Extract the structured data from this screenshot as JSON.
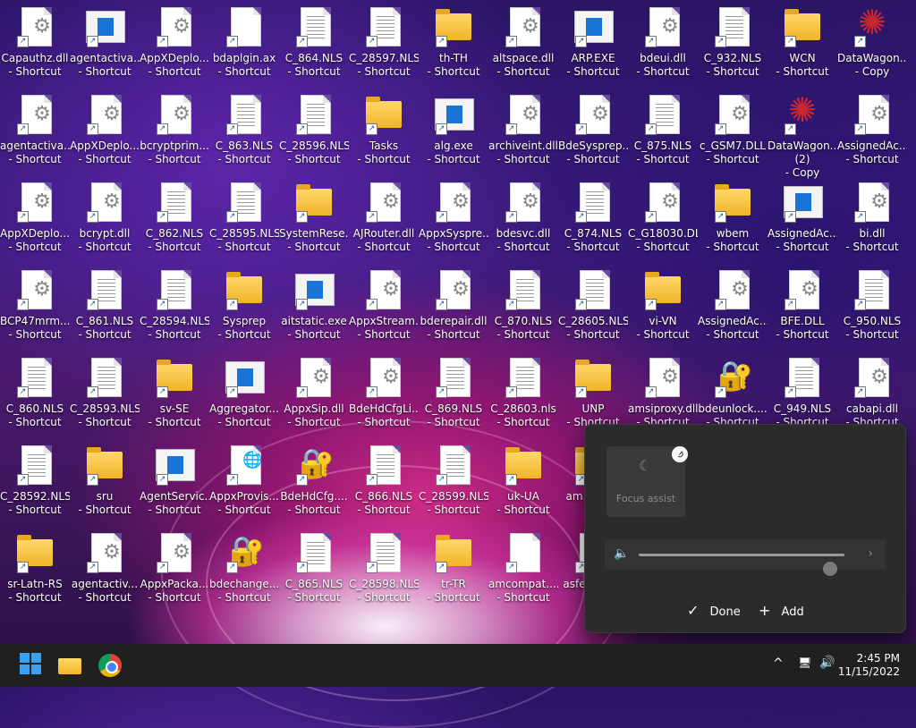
{
  "desktop": {
    "icons": [
      {
        "label": "Capauthz.dll - Shortcut",
        "type": "dll"
      },
      {
        "label": "agentactiva... - Shortcut",
        "type": "exe"
      },
      {
        "label": "AppXDeplo... - Shortcut",
        "type": "dll"
      },
      {
        "label": "bdaplgin.ax - Shortcut",
        "type": "file"
      },
      {
        "label": "C_864.NLS - Shortcut",
        "type": "nls"
      },
      {
        "label": "C_28597.NLS - Shortcut",
        "type": "nls"
      },
      {
        "label": "th-TH - Shortcut",
        "type": "folder"
      },
      {
        "label": "altspace.dll - Shortcut",
        "type": "dll"
      },
      {
        "label": "ARP.EXE - Shortcut",
        "type": "exe"
      },
      {
        "label": "bdeui.dll - Shortcut",
        "type": "dll"
      },
      {
        "label": "C_932.NLS - Shortcut",
        "type": "nls"
      },
      {
        "label": "WCN - Shortcut",
        "type": "folder"
      },
      {
        "label": "DataWagon... - Copy",
        "type": "star"
      },
      {
        "label": "agentactiva... - Shortcut",
        "type": "dll"
      },
      {
        "label": "AppXDeplo... - Shortcut",
        "type": "dll"
      },
      {
        "label": "bcryptprim... - Shortcut",
        "type": "dll"
      },
      {
        "label": "C_863.NLS - Shortcut",
        "type": "nls"
      },
      {
        "label": "C_28596.NLS - Shortcut",
        "type": "nls"
      },
      {
        "label": "Tasks - Shortcut",
        "type": "folder"
      },
      {
        "label": "alg.exe - Shortcut",
        "type": "exe"
      },
      {
        "label": "archiveint.dll - Shortcut",
        "type": "dll"
      },
      {
        "label": "BdeSysprep.... - Shortcut",
        "type": "dll"
      },
      {
        "label": "C_875.NLS - Shortcut",
        "type": "nls"
      },
      {
        "label": "c_GSM7.DLL - Shortcut",
        "type": "dll"
      },
      {
        "label": "DataWagon.... (2) - Copy",
        "type": "star"
      },
      {
        "label": "AssignedAc... - Shortcut",
        "type": "dll"
      },
      {
        "label": "AppXDeplo... - Shortcut",
        "type": "dll"
      },
      {
        "label": "bcrypt.dll - Shortcut",
        "type": "dll"
      },
      {
        "label": "C_862.NLS - Shortcut",
        "type": "nls"
      },
      {
        "label": "C_28595.NLS - Shortcut",
        "type": "nls"
      },
      {
        "label": "SystemRese... - Shortcut",
        "type": "folder"
      },
      {
        "label": "AJRouter.dll - Shortcut",
        "type": "dll"
      },
      {
        "label": "AppxSyspre... - Shortcut",
        "type": "dll"
      },
      {
        "label": "bdesvc.dll - Shortcut",
        "type": "dll"
      },
      {
        "label": "C_874.NLS - Shortcut",
        "type": "nls"
      },
      {
        "label": "C_G18030.DLL - Shortcut",
        "type": "dll"
      },
      {
        "label": "wbem - Shortcut",
        "type": "folder"
      },
      {
        "label": "AssignedAc... - Shortcut",
        "type": "exe"
      },
      {
        "label": "bi.dll - Shortcut",
        "type": "dll"
      },
      {
        "label": "BCP47mrm.... - Shortcut",
        "type": "dll"
      },
      {
        "label": "C_861.NLS - Shortcut",
        "type": "nls"
      },
      {
        "label": "C_28594.NLS - Shortcut",
        "type": "nls"
      },
      {
        "label": "Sysprep - Shortcut",
        "type": "folder"
      },
      {
        "label": "aitstatic.exe - Shortcut",
        "type": "exe"
      },
      {
        "label": "AppxStream... - Shortcut",
        "type": "dll"
      },
      {
        "label": "bderepair.dll - Shortcut",
        "type": "dll"
      },
      {
        "label": "C_870.NLS - Shortcut",
        "type": "nls"
      },
      {
        "label": "C_28605.NLS - Shortcut",
        "type": "nls"
      },
      {
        "label": "vi-VN - Shortcut",
        "type": "folder"
      },
      {
        "label": "AssignedAc... - Shortcut",
        "type": "dll"
      },
      {
        "label": "BFE.DLL - Shortcut",
        "type": "dll"
      },
      {
        "label": "C_950.NLS - Shortcut",
        "type": "nls"
      },
      {
        "label": "C_860.NLS - Shortcut",
        "type": "nls"
      },
      {
        "label": "C_28593.NLS - Shortcut",
        "type": "nls"
      },
      {
        "label": "sv-SE - Shortcut",
        "type": "folder"
      },
      {
        "label": "Aggregator... - Shortcut",
        "type": "exe"
      },
      {
        "label": "AppxSip.dll - Shortcut",
        "type": "dll"
      },
      {
        "label": "BdeHdCfgLi... - Shortcut",
        "type": "dll"
      },
      {
        "label": "C_869.NLS - Shortcut",
        "type": "nls"
      },
      {
        "label": "C_28603.nls - Shortcut",
        "type": "nls"
      },
      {
        "label": "UNP - Shortcut",
        "type": "folder"
      },
      {
        "label": "amsiproxy.dll - Shortcut",
        "type": "dll"
      },
      {
        "label": "bdeunlock.... - Shortcut",
        "type": "lock"
      },
      {
        "label": "C_949.NLS - Shortcut",
        "type": "nls"
      },
      {
        "label": "cabapi.dll - Shortcut",
        "type": "dll"
      },
      {
        "label": "C_28592.NLS - Shortcut",
        "type": "nls"
      },
      {
        "label": "sru - Shortcut",
        "type": "folder"
      },
      {
        "label": "AgentServic... - Shortcut",
        "type": "exe"
      },
      {
        "label": "AppxProvis... - Shortcut",
        "type": "web"
      },
      {
        "label": "BdeHdCfg.... - Shortcut",
        "type": "lock"
      },
      {
        "label": "C_866.NLS - Shortcut",
        "type": "nls"
      },
      {
        "label": "C_28599.NLS - Shortcut",
        "type": "nls"
      },
      {
        "label": "uk-UA - Shortcut",
        "type": "folder"
      },
      {
        "label": "am... Sh...",
        "type": "folder"
      },
      {
        "label": "sr-Latn-RS - Shortcut",
        "type": "folder"
      },
      {
        "label": "agentactiv... - Shortcut",
        "type": "dll"
      },
      {
        "label": "AppxPacka... - Shortcut",
        "type": "dll"
      },
      {
        "label": "bdechange.... - Shortcut",
        "type": "lock"
      },
      {
        "label": "C_865.NLS - Shortcut",
        "type": "nls"
      },
      {
        "label": "C_28598.NLS - Shortcut",
        "type": "nls"
      },
      {
        "label": "tr-TR - Shortcut",
        "type": "folder"
      },
      {
        "label": "amcompat.... - Shortcut",
        "type": "file"
      },
      {
        "label": "asfe... Sh...",
        "type": "dll"
      }
    ]
  },
  "quick_settings": {
    "tile_label": "Focus assist",
    "unpin_icon": "unpin-icon",
    "volume_level": 0.93,
    "done_label": "Done",
    "add_label": "Add"
  },
  "taskbar": {
    "time": "2:45 PM",
    "date": "11/15/2022",
    "accent": "#3aa0f0"
  }
}
